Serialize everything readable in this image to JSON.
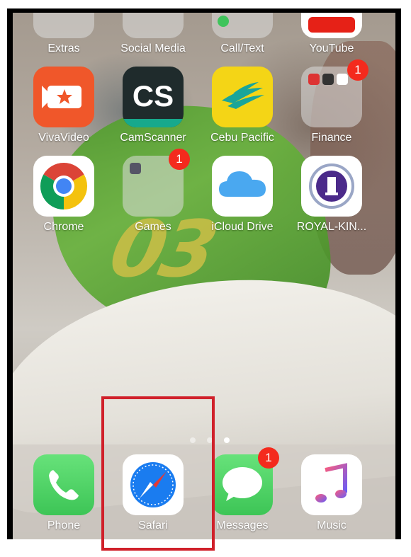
{
  "home_screen": {
    "top_row": [
      {
        "label": "Extras",
        "icon": "folder-icon"
      },
      {
        "label": "Social Media",
        "icon": "folder-icon"
      },
      {
        "label": "Call/Text",
        "icon": "folder-icon"
      },
      {
        "label": "YouTube",
        "icon": "youtube-icon"
      }
    ],
    "row2": [
      {
        "label": "VivaVideo",
        "icon": "vivavideo-icon",
        "color": "#f0572a"
      },
      {
        "label": "CamScanner",
        "icon": "camscanner-icon",
        "text": "CS",
        "color": "#1e2a2a"
      },
      {
        "label": "Cebu Pacific",
        "icon": "cebu-pacific-icon",
        "color": "#f4d516"
      },
      {
        "label": "Finance",
        "icon": "folder-icon",
        "badge": "1"
      }
    ],
    "row3": [
      {
        "label": "Chrome",
        "icon": "chrome-icon"
      },
      {
        "label": "Games",
        "icon": "folder-icon",
        "badge": "1"
      },
      {
        "label": "iCloud Drive",
        "icon": "icloud-icon"
      },
      {
        "label": "ROYAL-KIN...",
        "icon": "royal-kin-icon"
      }
    ]
  },
  "wallpaper_number": "03",
  "page_indicator": {
    "pages": 3,
    "active": 3
  },
  "dock": [
    {
      "label": "Phone",
      "icon": "phone-icon",
      "color": "#4cd964"
    },
    {
      "label": "Safari",
      "icon": "safari-icon",
      "color": "#1a7cf0"
    },
    {
      "label": "Messages",
      "icon": "messages-icon",
      "color": "#4cd964",
      "badge": "1"
    },
    {
      "label": "Music",
      "icon": "music-icon",
      "color": "#fc3c5f"
    }
  ],
  "highlight_color": "#d0202a"
}
